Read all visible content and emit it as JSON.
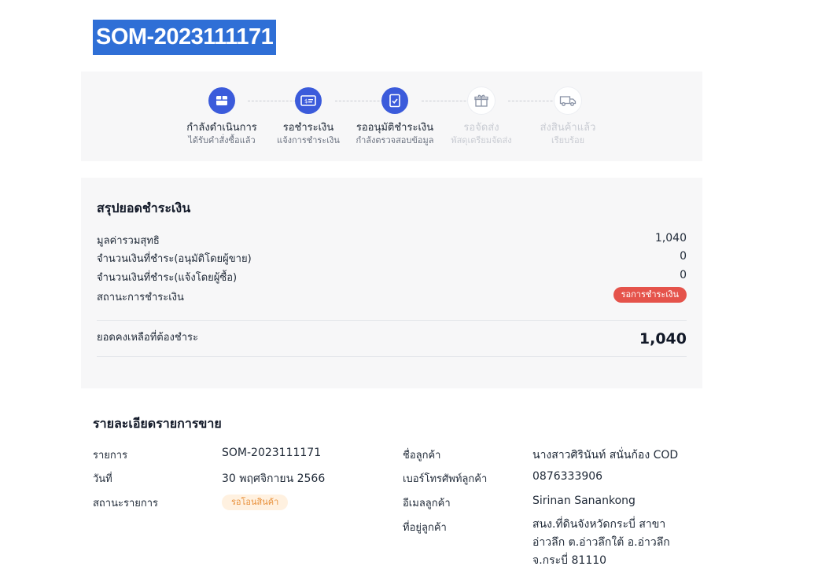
{
  "order": {
    "number": "SOM-2023111171"
  },
  "steps": [
    {
      "label": "กำลังดำเนินการ",
      "sub": "ได้รับคำสั่งซื้อแล้ว",
      "icon": "box-icon",
      "state": "active"
    },
    {
      "label": "รอชำระเงิน",
      "sub": "แจ้งการชำระเงิน",
      "icon": "payment-card-icon",
      "state": "active"
    },
    {
      "label": "รออนุมัติชำระเงิน",
      "sub": "กำลังตรวจสอบข้อมูล",
      "icon": "document-check-icon",
      "state": "active"
    },
    {
      "label": "รอจัดส่ง",
      "sub": "พัสดุเตรียมจัดส่ง",
      "icon": "gift-box-icon",
      "state": "inactive"
    },
    {
      "label": "ส่งสินค้าแล้ว",
      "sub": "เรียบร้อย",
      "icon": "truck-icon",
      "state": "inactive"
    }
  ],
  "summary": {
    "title": "สรุปยอดชำระเงิน",
    "rows": [
      {
        "label": "มูลค่ารวมสุทธิ",
        "value": "1,040"
      },
      {
        "label": "จำนวนเงินที่ชำระ(อนุมัติโดยผู้ขาย)",
        "value": "0"
      },
      {
        "label": "จำนวนเงินที่ชำระ(แจ้งโดยผู้ซื้อ)",
        "value": "0"
      }
    ],
    "status_label": "สถานะการชำระเงิน",
    "status_value": "รอการชำระเงิน",
    "balance_label": "ยอดคงเหลือที่ต้องชำระ",
    "balance_value": "1,040"
  },
  "details": {
    "title": "รายละเอียดรายการขาย",
    "item_label": "รายการ",
    "item_value": "SOM-2023111171",
    "date_label": "วันที่",
    "date_value": "30 พฤศจิกายน 2566",
    "status_label": "สถานะรายการ",
    "status_value": "รอโอนสินค้า",
    "customer_name_label": "ชื่อลูกค้า",
    "customer_name_value": "นางสาวศิรินันท์ สนั่นก้อง COD",
    "phone_label": "เบอร์โทรศัพท์ลูกค้า",
    "phone_value": "0876333906",
    "email_label": "อีเมลลูกค้า",
    "email_value": "Sirinan Sanankong",
    "address_label": "ที่อยู่ลูกค้า",
    "address_value": "สนง.ที่ดินจังหวัดกระบี่ สาขา\nอ่าวลึก ต.อ่าวลึกใต้ อ.อ่าวลึก\nจ.กระบี่ 81110"
  },
  "colors": {
    "accent": "#3b5bdb",
    "highlight": "#2f6fd6",
    "payment_status": "#e5534b",
    "order_status_bg": "#fff1e0",
    "order_status_text": "#e8903a"
  }
}
